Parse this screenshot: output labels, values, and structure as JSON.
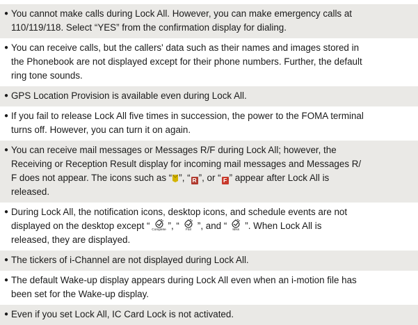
{
  "notes": [
    {
      "lines": [
        "You cannot make calls during Lock All. However, you can make emergency calls at",
        "110/119/118. Select “YES” from the confirmation display for dialing."
      ]
    },
    {
      "lines": [
        "You can receive calls, but the callers' data such as their names and images stored in",
        "the Phonebook are not displayed except for their phone numbers. Further, the default",
        "ring tone sounds."
      ]
    },
    {
      "lines": [
        "GPS Location Provision is available even during Lock All."
      ]
    },
    {
      "lines": [
        "If you fail to release Lock All five times in succession, the power to the FOMA terminal",
        "turns off. However, you can turn it on again."
      ]
    },
    {
      "lines": [
        "You can receive mail messages or Messages R/F during Lock All; however, the",
        "Receiving or Reception Result display for incoming mail messages and Messages R/",
        "F does not appear. The icons such as “",
        "released."
      ],
      "icon_line": {
        "sep1": "”, “",
        "sep2": "”, or “",
        "tail": "” appear after Lock All is",
        "icons": [
          "mail-icon",
          "messages-r-icon",
          "messages-f-icon"
        ],
        "r_letter": "R",
        "f_letter": "F"
      }
    },
    {
      "lines": [
        "During Lock All, the notification icons, desktop icons, and schedule events are not",
        "displayed on the desktop except “",
        "released, they are displayed."
      ],
      "sched_line": {
        "sep1": "”, “",
        "sep2": "”, and “",
        "tail": "”. When Lock All is",
        "captions": [
          "Complete",
          "Fail",
          "Miss"
        ],
        "icons": [
          "schedule-complete-icon",
          "schedule-fail-icon",
          "schedule-miss-icon"
        ]
      }
    },
    {
      "lines": [
        "The tickers of i-Channel are not displayed during Lock All."
      ]
    },
    {
      "lines": [
        "The default Wake-up display appears during Lock All even when an i-motion file has",
        "been set for the Wake-up display."
      ]
    },
    {
      "lines": [
        "Even if you set Lock All, IC Card Lock is not activated."
      ]
    }
  ],
  "bullet_glyph": "●",
  "colors": {
    "shade": "#eae9e6",
    "text": "#1a1a1a",
    "icon_red": "#b03a2e",
    "mail_icon": "#d4b400"
  }
}
